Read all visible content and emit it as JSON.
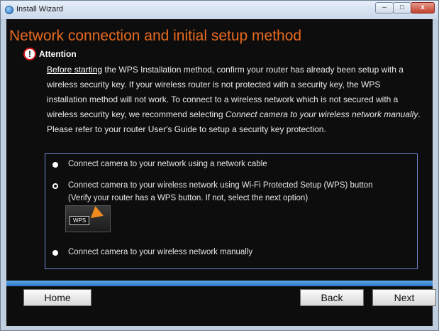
{
  "window": {
    "title": "Install Wizard",
    "minimize": "–",
    "maximize": "□",
    "close": "x"
  },
  "heading": "Network connection and initial setup method",
  "attention": {
    "icon": "!",
    "label": "Attention"
  },
  "paragraph": {
    "underlined": "Before starting",
    "part1": " the WPS Installation method, confirm your router has already been setup with a wireless security key. If your wireless router is not protected with a security key, the WPS installation method will not work. To connect to a wireless network which is not secured with a wireless security key, we recommend selecting ",
    "italic": "Connect camera to your wireless network manually",
    "part2": ". Please refer to your router User's Guide to setup a security key protection."
  },
  "options": [
    {
      "label": "Connect camera to your network using a network cable",
      "selected": false
    },
    {
      "label": "Connect camera to your wireless network using Wi-Fi Protected Setup (WPS) button",
      "sub": "(Verify your router has a WPS button. If not, select the next option)",
      "selected": true,
      "image_label": "WPS"
    },
    {
      "label": "Connect camera to your wireless network manually",
      "selected": false
    }
  ],
  "buttons": {
    "home": "Home",
    "back": "Back",
    "next": "Next"
  }
}
